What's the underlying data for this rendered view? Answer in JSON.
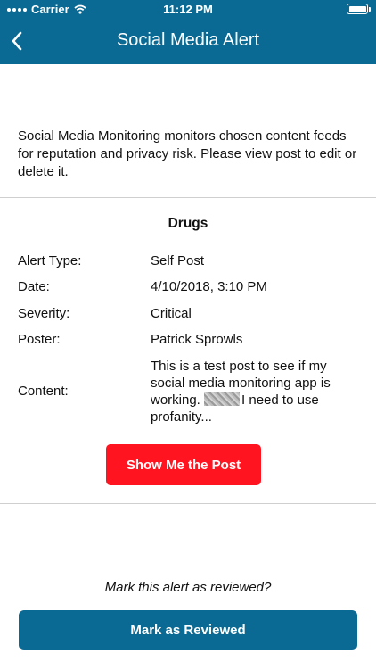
{
  "status_bar": {
    "carrier": "Carrier",
    "time": "11:12 PM",
    "icons": [
      "signal-icon",
      "wifi-icon",
      "battery-icon"
    ]
  },
  "header": {
    "title": "Social Media Alert",
    "back_icon": "chevron-left-icon",
    "background": "#0b6a93"
  },
  "intro": "Social Media Monitoring monitors chosen content feeds for reputation and privacy risk. Please view post to edit or delete it.",
  "alert": {
    "title": "Drugs",
    "rows": [
      {
        "label": "Alert Type:",
        "value": "Self Post"
      },
      {
        "label": "Date:",
        "value": "4/10/2018, 3:10 PM"
      },
      {
        "label": "Severity:",
        "value": "Critical"
      },
      {
        "label": "Poster:",
        "value": "Patrick Sprowls"
      }
    ],
    "content_label": "Content:",
    "content_before": "This is a test post to see if my social media monitoring app is working.",
    "content_after": "I need to use profanity..."
  },
  "buttons": {
    "show_post": "Show Me the Post",
    "show_post_color": "#ff1420",
    "review_prompt": "Mark this alert as reviewed?",
    "mark_reviewed": "Mark as Reviewed"
  }
}
